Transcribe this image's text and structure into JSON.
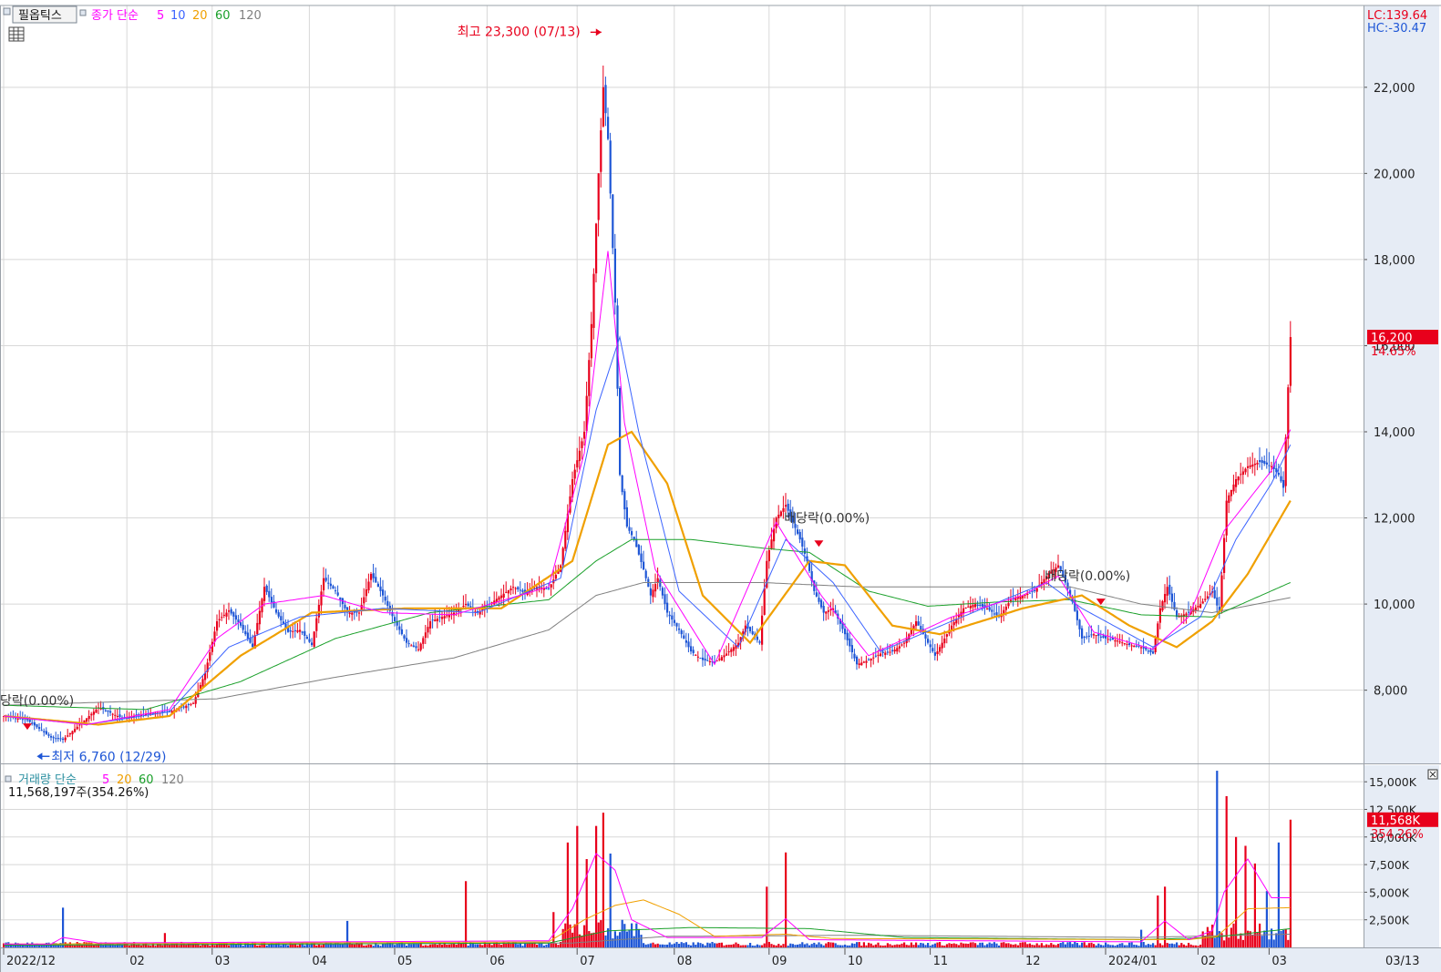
{
  "header": {
    "stock_button": "필옵틱스",
    "price_ma_title": "종가 단순",
    "price_ma_periods": [
      "5",
      "10",
      "20",
      "60",
      "120"
    ],
    "volume_title": "거래량 단순",
    "volume_ma_periods": [
      "5",
      "20",
      "60",
      "120"
    ],
    "volume_readout": "11,568,197주(354.26%)",
    "lc_readout": "LC:139.64",
    "hc_readout": "HC:-30.47"
  },
  "colors": {
    "up": "#e8001c",
    "down": "#1e56d6",
    "ma5": "#ff00ff",
    "ma10": "#3c64ff",
    "ma20": "#f0a000",
    "ma60": "#1aa02a",
    "ma120": "#808080",
    "vol_ma5": "#ff00ff",
    "vol_ma20": "#f0a000",
    "vol_ma60": "#1aa02a",
    "vol_ma120": "#808080",
    "axis_panel": "#e6ecf5",
    "grid": "#d8d8d8"
  },
  "chart_data": [
    {
      "type": "candlestick",
      "name": "price",
      "x_axis_labels": [
        "2022/12",
        "02",
        "03",
        "04",
        "05",
        "06",
        "07",
        "08",
        "09",
        "10",
        "11",
        "12",
        "2024/01",
        "02",
        "03",
        "03/13"
      ],
      "y_ticks": [
        "8,000",
        "10,000",
        "12,000",
        "14,000",
        "16,000",
        "18,000",
        "20,000",
        "22,000"
      ],
      "y_tick_values": [
        8000,
        10000,
        12000,
        14000,
        16000,
        18000,
        20000,
        22000
      ],
      "ylim": [
        6300,
        23900
      ],
      "current_price": "16,200",
      "current_change": "14.65%",
      "annotations": [
        {
          "text": "최고 23,300 (07/13)",
          "value": 23300
        },
        {
          "text": "최저 6,760 (12/29)",
          "value": 6760
        },
        {
          "text": "당락(0.00%)",
          "value": 7650
        },
        {
          "text": "배당락(0.00%)",
          "value": 11900
        },
        {
          "text": "배당락(0.00%)",
          "value": 10550
        }
      ],
      "close_path": [
        [
          0,
          7400
        ],
        [
          10,
          7300
        ],
        [
          20,
          6900
        ],
        [
          25,
          6850
        ],
        [
          30,
          7100
        ],
        [
          40,
          7600
        ],
        [
          50,
          7350
        ],
        [
          60,
          7450
        ],
        [
          70,
          7500
        ],
        [
          80,
          7700
        ],
        [
          85,
          8400
        ],
        [
          90,
          9600
        ],
        [
          95,
          9850
        ],
        [
          100,
          9500
        ],
        [
          105,
          9000
        ],
        [
          110,
          10400
        ],
        [
          115,
          9800
        ],
        [
          120,
          9350
        ],
        [
          125,
          9400
        ],
        [
          130,
          9050
        ],
        [
          135,
          10600
        ],
        [
          140,
          10300
        ],
        [
          145,
          9800
        ],
        [
          150,
          9800
        ],
        [
          155,
          10700
        ],
        [
          160,
          10200
        ],
        [
          165,
          9600
        ],
        [
          170,
          9100
        ],
        [
          175,
          8950
        ],
        [
          180,
          9600
        ],
        [
          185,
          9700
        ],
        [
          190,
          9800
        ],
        [
          195,
          10000
        ],
        [
          200,
          9800
        ],
        [
          205,
          10000
        ],
        [
          210,
          10200
        ],
        [
          215,
          10400
        ],
        [
          220,
          10250
        ],
        [
          225,
          10400
        ],
        [
          230,
          10350
        ],
        [
          235,
          10900
        ],
        [
          240,
          12900
        ],
        [
          245,
          14000
        ],
        [
          248,
          16500
        ],
        [
          251,
          20000
        ],
        [
          253,
          22000
        ],
        [
          255,
          20800
        ],
        [
          258,
          17000
        ],
        [
          260,
          13000
        ],
        [
          263,
          11800
        ],
        [
          266,
          11500
        ],
        [
          270,
          10800
        ],
        [
          273,
          10200
        ],
        [
          276,
          10600
        ],
        [
          280,
          9800
        ],
        [
          285,
          9400
        ],
        [
          290,
          8900
        ],
        [
          295,
          8700
        ],
        [
          300,
          8650
        ],
        [
          305,
          8850
        ],
        [
          310,
          9100
        ],
        [
          313,
          9500
        ],
        [
          316,
          9300
        ],
        [
          319,
          9100
        ],
        [
          322,
          11000
        ],
        [
          326,
          12000
        ],
        [
          330,
          12300
        ],
        [
          333,
          11900
        ],
        [
          336,
          11500
        ],
        [
          339,
          11000
        ],
        [
          342,
          10300
        ],
        [
          346,
          9800
        ],
        [
          350,
          9900
        ],
        [
          355,
          9300
        ],
        [
          360,
          8600
        ],
        [
          365,
          8700
        ],
        [
          370,
          8850
        ],
        [
          375,
          8900
        ],
        [
          380,
          9100
        ],
        [
          385,
          9600
        ],
        [
          390,
          9100
        ],
        [
          393,
          8800
        ],
        [
          396,
          9100
        ],
        [
          400,
          9500
        ],
        [
          405,
          9900
        ],
        [
          410,
          10000
        ],
        [
          415,
          9900
        ],
        [
          420,
          9700
        ],
        [
          425,
          10100
        ],
        [
          430,
          10200
        ],
        [
          435,
          10300
        ],
        [
          440,
          10650
        ],
        [
          445,
          10900
        ],
        [
          448,
          10500
        ],
        [
          451,
          10050
        ],
        [
          455,
          9200
        ],
        [
          460,
          9300
        ],
        [
          465,
          9200
        ],
        [
          470,
          9150
        ],
        [
          475,
          9050
        ],
        [
          480,
          9000
        ],
        [
          485,
          8850
        ],
        [
          488,
          9900
        ],
        [
          491,
          10400
        ],
        [
          495,
          9700
        ],
        [
          500,
          9800
        ],
        [
          505,
          10000
        ],
        [
          510,
          10300
        ],
        [
          513,
          9800
        ],
        [
          516,
          12400
        ],
        [
          520,
          12900
        ],
        [
          525,
          13200
        ],
        [
          530,
          13300
        ],
        [
          535,
          13200
        ],
        [
          538,
          13000
        ],
        [
          540,
          12700
        ],
        [
          543,
          16200
        ]
      ],
      "ma_anchors": {
        "ma5": [
          [
            0,
            7400
          ],
          [
            35,
            7200
          ],
          [
            70,
            7550
          ],
          [
            90,
            9200
          ],
          [
            110,
            10000
          ],
          [
            135,
            10200
          ],
          [
            160,
            9800
          ],
          [
            190,
            9750
          ],
          [
            230,
            10400
          ],
          [
            245,
            13500
          ],
          [
            255,
            18200
          ],
          [
            262,
            14200
          ],
          [
            275,
            10800
          ],
          [
            300,
            8600
          ],
          [
            326,
            11900
          ],
          [
            345,
            10200
          ],
          [
            365,
            8800
          ],
          [
            400,
            9700
          ],
          [
            430,
            10200
          ],
          [
            445,
            10650
          ],
          [
            460,
            9350
          ],
          [
            485,
            8950
          ],
          [
            500,
            9700
          ],
          [
            515,
            11700
          ],
          [
            535,
            13100
          ],
          [
            543,
            14050
          ]
        ],
        "ma10": [
          [
            0,
            7400
          ],
          [
            35,
            7200
          ],
          [
            70,
            7500
          ],
          [
            95,
            9000
          ],
          [
            125,
            9700
          ],
          [
            160,
            9900
          ],
          [
            200,
            9800
          ],
          [
            235,
            10600
          ],
          [
            250,
            14500
          ],
          [
            260,
            16200
          ],
          [
            268,
            14000
          ],
          [
            285,
            10300
          ],
          [
            310,
            9000
          ],
          [
            330,
            11500
          ],
          [
            350,
            10500
          ],
          [
            370,
            8900
          ],
          [
            400,
            9600
          ],
          [
            440,
            10500
          ],
          [
            455,
            9900
          ],
          [
            485,
            9000
          ],
          [
            505,
            9700
          ],
          [
            520,
            11500
          ],
          [
            535,
            12800
          ],
          [
            543,
            13700
          ]
        ],
        "ma20": [
          [
            0,
            7400
          ],
          [
            40,
            7200
          ],
          [
            70,
            7400
          ],
          [
            100,
            8800
          ],
          [
            130,
            9800
          ],
          [
            170,
            9900
          ],
          [
            210,
            9900
          ],
          [
            240,
            11000
          ],
          [
            255,
            13700
          ],
          [
            265,
            14000
          ],
          [
            280,
            12800
          ],
          [
            295,
            10200
          ],
          [
            315,
            9100
          ],
          [
            340,
            11000
          ],
          [
            355,
            10900
          ],
          [
            375,
            9500
          ],
          [
            395,
            9300
          ],
          [
            430,
            9900
          ],
          [
            455,
            10200
          ],
          [
            475,
            9500
          ],
          [
            495,
            9000
          ],
          [
            510,
            9600
          ],
          [
            525,
            10700
          ],
          [
            543,
            12400
          ]
        ],
        "ma60": [
          [
            0,
            7650
          ],
          [
            60,
            7550
          ],
          [
            100,
            8200
          ],
          [
            140,
            9200
          ],
          [
            180,
            9800
          ],
          [
            230,
            10100
          ],
          [
            250,
            11000
          ],
          [
            265,
            11500
          ],
          [
            290,
            11500
          ],
          [
            320,
            11300
          ],
          [
            340,
            11200
          ],
          [
            365,
            10300
          ],
          [
            390,
            9950
          ],
          [
            420,
            10050
          ],
          [
            450,
            10100
          ],
          [
            480,
            9750
          ],
          [
            510,
            9700
          ],
          [
            543,
            10500
          ]
        ],
        "ma120": [
          [
            0,
            7650
          ],
          [
            90,
            7800
          ],
          [
            140,
            8300
          ],
          [
            190,
            8750
          ],
          [
            230,
            9400
          ],
          [
            250,
            10200
          ],
          [
            270,
            10500
          ],
          [
            320,
            10500
          ],
          [
            360,
            10400
          ],
          [
            420,
            10400
          ],
          [
            450,
            10400
          ],
          [
            480,
            10000
          ],
          [
            510,
            9800
          ],
          [
            543,
            10150
          ]
        ]
      }
    },
    {
      "type": "bar",
      "name": "volume",
      "unit": "주",
      "y_ticks": [
        "2,500K",
        "5,000K",
        "7,500K",
        "10,000K",
        "12,500K",
        "15,000K"
      ],
      "y_tick_values": [
        2500,
        5000,
        7500,
        10000,
        12500,
        15000
      ],
      "ylim": [
        0,
        16500
      ],
      "current_volume_k": "11,568K",
      "current_volume_pct": "354.26%",
      "current_volume_value": 11568,
      "spikes": [
        [
          25,
          3600
        ],
        [
          68,
          1300
        ],
        [
          145,
          2400
        ],
        [
          195,
          6000
        ],
        [
          232,
          3200
        ],
        [
          238,
          9500
        ],
        [
          242,
          11000
        ],
        [
          246,
          8000
        ],
        [
          250,
          11000
        ],
        [
          253,
          12200
        ],
        [
          256,
          8500
        ],
        [
          322,
          5500
        ],
        [
          330,
          8600
        ],
        [
          480,
          1600
        ],
        [
          487,
          4700
        ],
        [
          490,
          5500
        ],
        [
          512,
          16000
        ],
        [
          516,
          13700
        ],
        [
          520,
          10000
        ],
        [
          524,
          9200
        ],
        [
          528,
          7600
        ],
        [
          533,
          5100
        ],
        [
          538,
          9500
        ],
        [
          543,
          11568
        ]
      ],
      "ma_anchors": {
        "vol_ma5": [
          [
            0,
            300
          ],
          [
            20,
            300
          ],
          [
            25,
            900
          ],
          [
            40,
            400
          ],
          [
            230,
            600
          ],
          [
            240,
            3500
          ],
          [
            250,
            8500
          ],
          [
            258,
            7000
          ],
          [
            265,
            2500
          ],
          [
            280,
            900
          ],
          [
            320,
            900
          ],
          [
            330,
            2600
          ],
          [
            340,
            700
          ],
          [
            480,
            500
          ],
          [
            490,
            2400
          ],
          [
            500,
            700
          ],
          [
            510,
            1500
          ],
          [
            515,
            5000
          ],
          [
            525,
            8000
          ],
          [
            535,
            4500
          ],
          [
            543,
            4500
          ]
        ],
        "vol_ma20": [
          [
            0,
            300
          ],
          [
            230,
            500
          ],
          [
            245,
            2500
          ],
          [
            258,
            3800
          ],
          [
            270,
            4300
          ],
          [
            285,
            3000
          ],
          [
            300,
            1000
          ],
          [
            330,
            1200
          ],
          [
            350,
            800
          ],
          [
            500,
            700
          ],
          [
            512,
            1000
          ],
          [
            525,
            3500
          ],
          [
            543,
            3600
          ]
        ],
        "vol_ma60": [
          [
            0,
            200
          ],
          [
            230,
            400
          ],
          [
            255,
            1500
          ],
          [
            290,
            1800
          ],
          [
            340,
            1700
          ],
          [
            380,
            900
          ],
          [
            480,
            700
          ],
          [
            510,
            900
          ],
          [
            543,
            1700
          ]
        ],
        "vol_ma120": [
          [
            0,
            200
          ],
          [
            240,
            400
          ],
          [
            280,
            1000
          ],
          [
            360,
            1100
          ],
          [
            480,
            900
          ],
          [
            543,
            1200
          ]
        ]
      }
    }
  ]
}
